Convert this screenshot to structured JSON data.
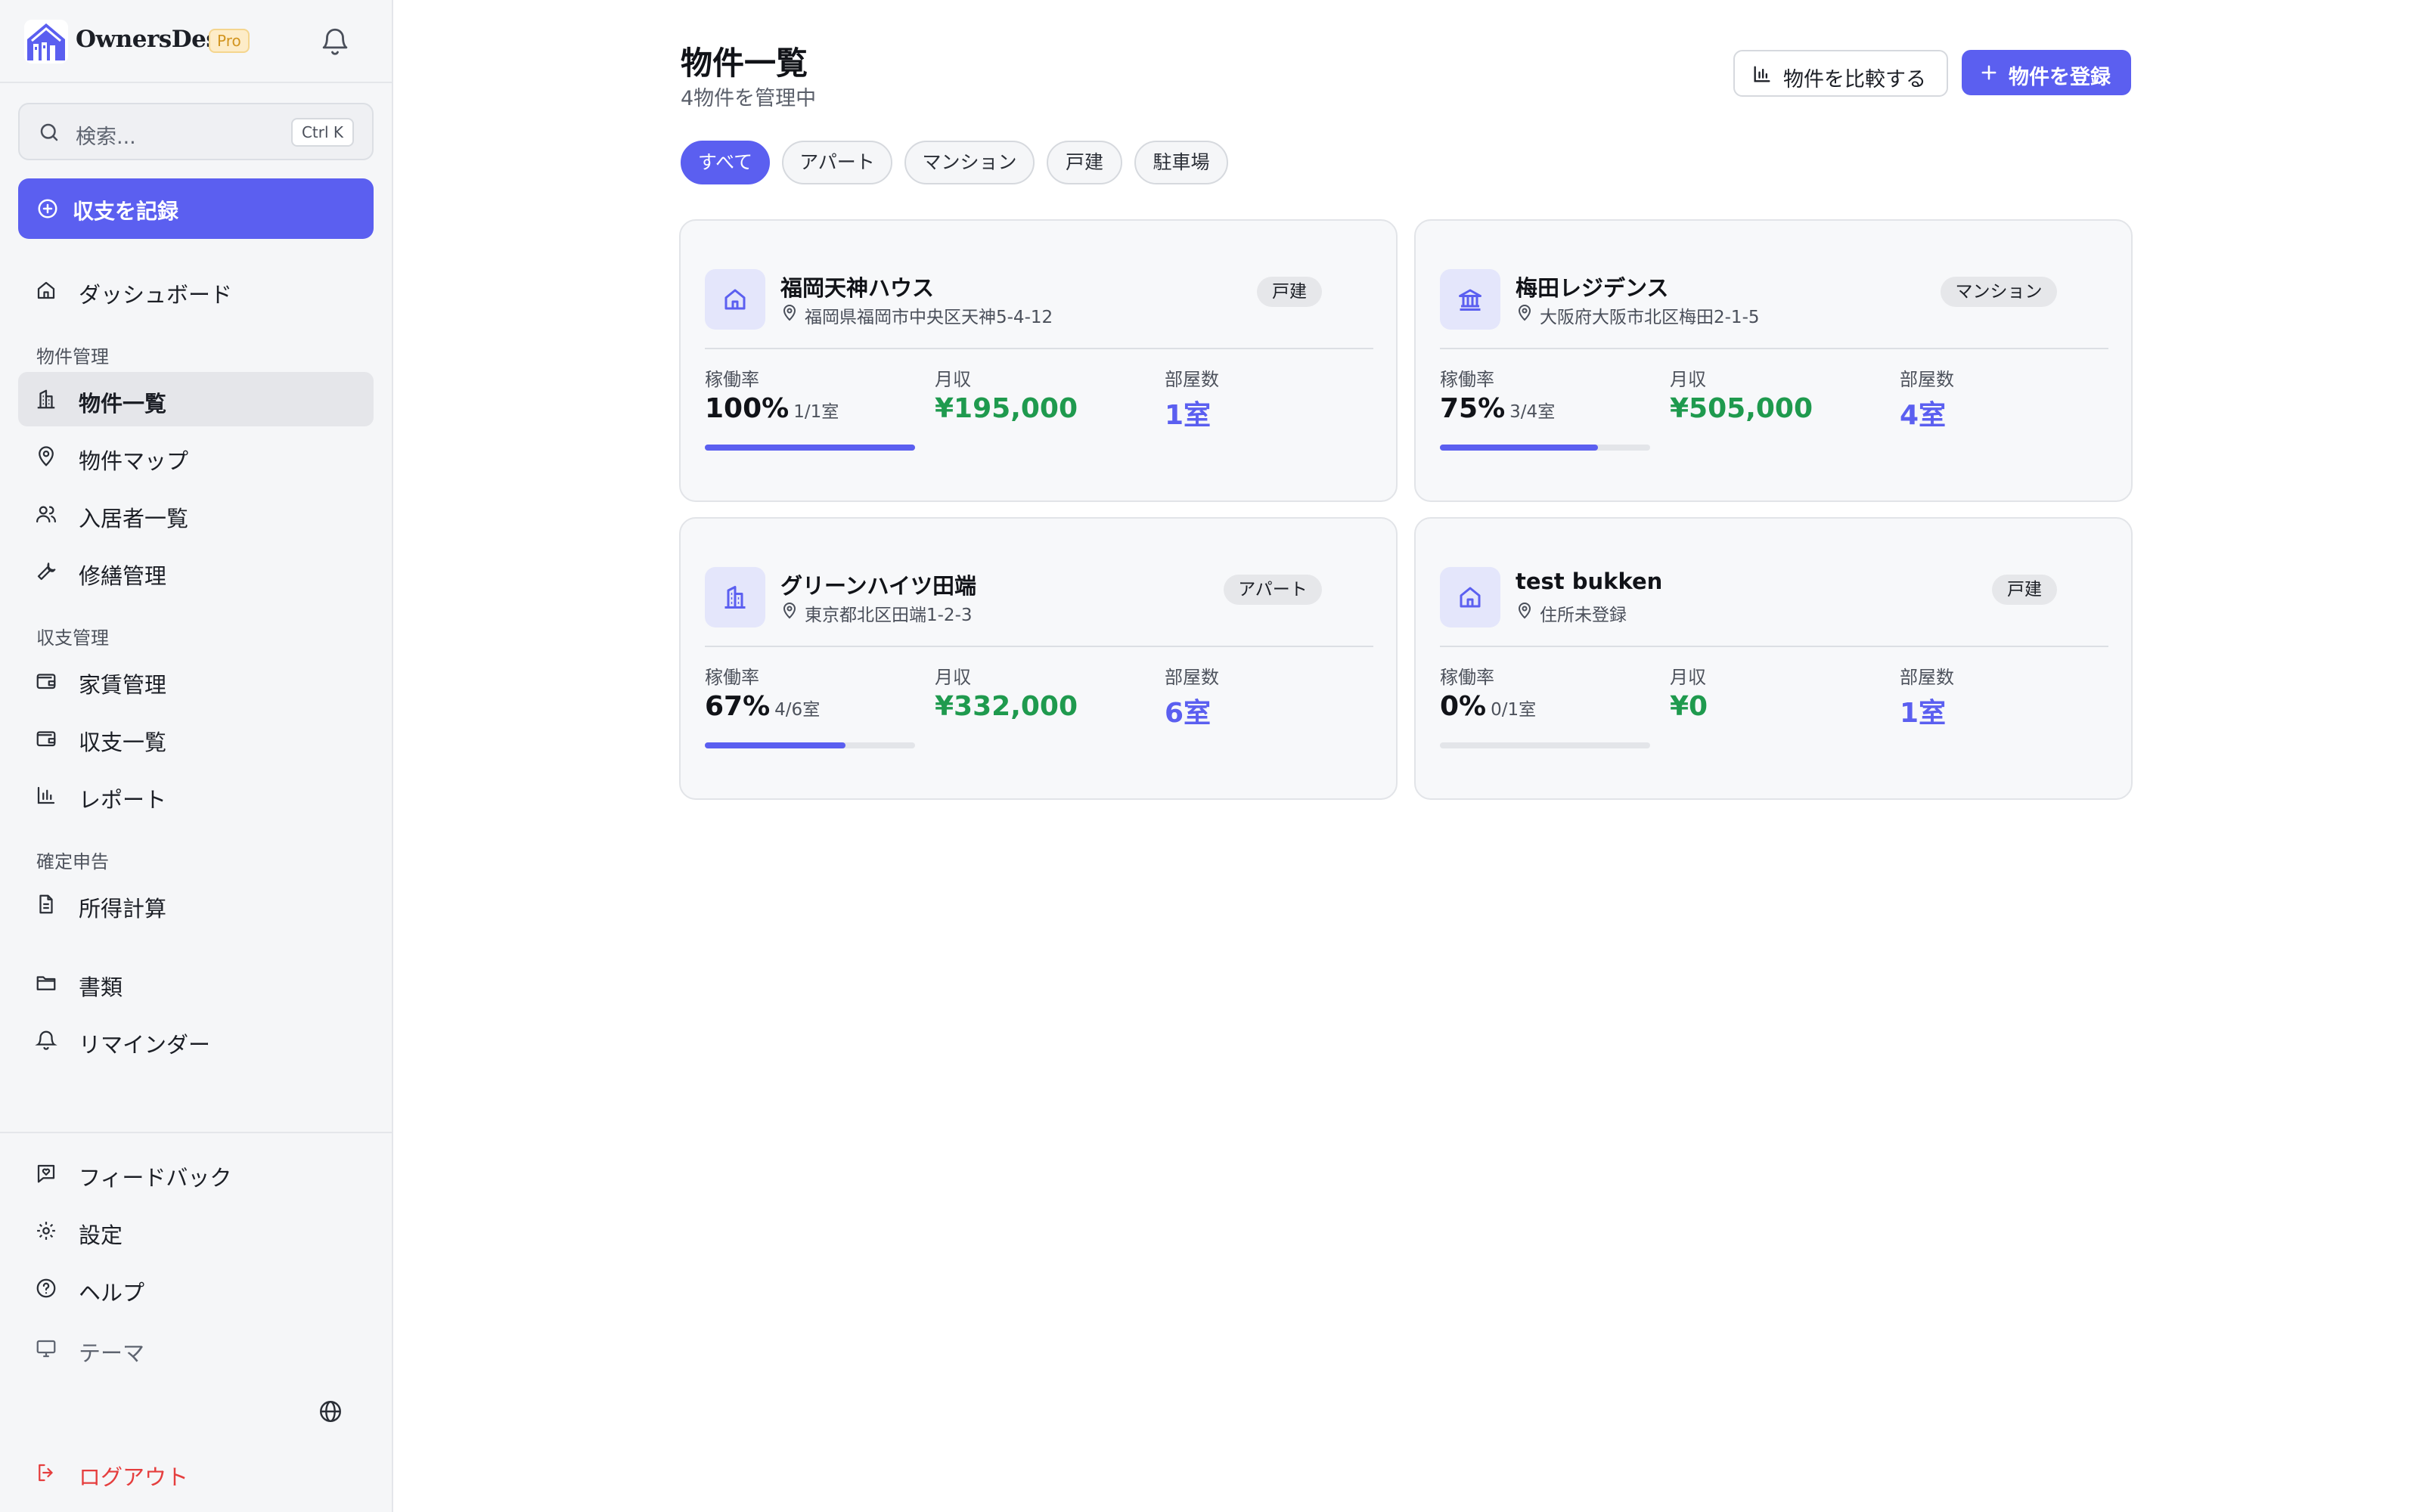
{
  "app": {
    "name": "OwnersDesk",
    "plan_badge": "Pro"
  },
  "sidebar": {
    "search_placeholder": "検索...",
    "search_shortcut": "Ctrl K",
    "record_button": "収支を記録",
    "dashboard": "ダッシュボード",
    "sections": {
      "property": "物件管理",
      "finance": "収支管理",
      "tax": "確定申告"
    },
    "items": {
      "property_list": "物件一覧",
      "property_map": "物件マップ",
      "tenants": "入居者一覧",
      "repairs": "修繕管理",
      "rent": "家賃管理",
      "transactions": "収支一覧",
      "reports": "レポート",
      "income_calc": "所得計算",
      "documents": "書類",
      "reminders": "リマインダー",
      "feedback": "フィードバック",
      "settings": "設定",
      "help": "ヘルプ",
      "theme": "テーマ",
      "logout": "ログアウト"
    }
  },
  "main": {
    "title": "物件一覧",
    "subtitle": "4物件を管理中",
    "compare_button": "物件を比較する",
    "add_button": "物件を登録",
    "filters": [
      "すべて",
      "アパート",
      "マンション",
      "戸建",
      "駐車場"
    ],
    "active_filter": "すべて",
    "metric_labels": {
      "occupancy": "稼働率",
      "income": "月収",
      "rooms": "部屋数"
    },
    "properties": [
      {
        "name": "福岡天神ハウス",
        "address": "福岡県福岡市中央区天神5-4-12",
        "type": "戸建",
        "icon": "house-icon",
        "occupancy": "100%",
        "occupancy_detail": "1/1室",
        "occupancy_fraction": 1.0,
        "income": "¥195,000",
        "rooms": "1室"
      },
      {
        "name": "梅田レジデンス",
        "address": "大阪府大阪市北区梅田2-1-5",
        "type": "マンション",
        "icon": "landmark-icon",
        "occupancy": "75%",
        "occupancy_detail": "3/4室",
        "occupancy_fraction": 0.75,
        "income": "¥505,000",
        "rooms": "4室"
      },
      {
        "name": "グリーンハイツ田端",
        "address": "東京都北区田端1-2-3",
        "type": "アパート",
        "icon": "building-icon",
        "occupancy": "67%",
        "occupancy_detail": "4/6室",
        "occupancy_fraction": 0.67,
        "income": "¥332,000",
        "rooms": "6室"
      },
      {
        "name": "test bukken",
        "address": "住所未登録",
        "type": "戸建",
        "icon": "house-icon",
        "occupancy": "0%",
        "occupancy_detail": "0/1室",
        "occupancy_fraction": 0.0,
        "income": "¥0",
        "rooms": "1室"
      }
    ]
  },
  "colors": {
    "accent": "#5b5ff0",
    "income": "#1f9a4e",
    "danger": "#e53e3e"
  }
}
